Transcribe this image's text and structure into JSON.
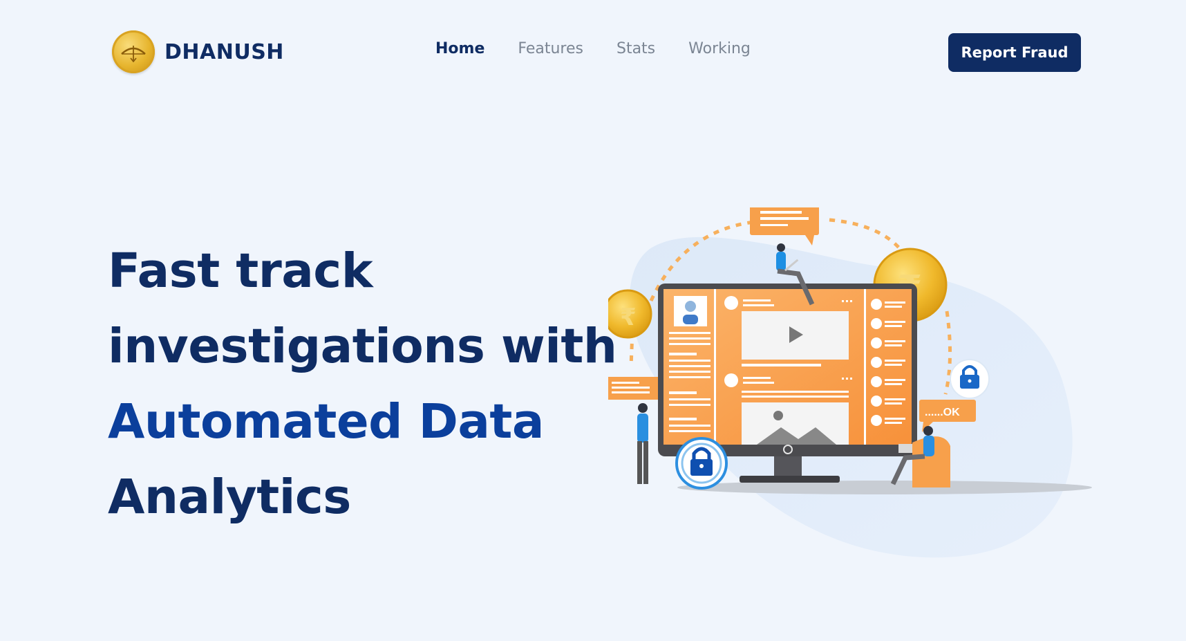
{
  "brand": {
    "name": "DHANUSH",
    "logo_icon": "bow-arrow-coin-icon"
  },
  "nav": {
    "items": [
      {
        "label": "Home",
        "active": true
      },
      {
        "label": "Features",
        "active": false
      },
      {
        "label": "Stats",
        "active": false
      },
      {
        "label": "Working",
        "active": false
      }
    ]
  },
  "cta": {
    "label": "Report Fraud"
  },
  "hero": {
    "line1": "Fast track",
    "line2": "investigations with",
    "line3": "Automated Data",
    "line4": "Analytics"
  },
  "illustration": {
    "ok_label": "......OK",
    "currency_symbol": "₹"
  },
  "colors": {
    "background": "#f0f5fc",
    "primary_navy": "#0f2c63",
    "accent_blue": "#0b3f9c",
    "orange": "#f7a04b",
    "gold": "#e8b42f"
  }
}
